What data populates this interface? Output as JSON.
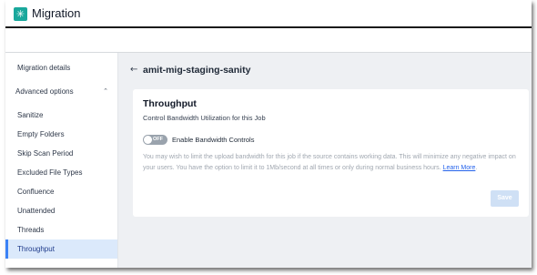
{
  "app": {
    "title": "Migration",
    "logo_icon": "snowflake-icon"
  },
  "sidebar": {
    "items": [
      {
        "label": "Migration details"
      },
      {
        "label": "Advanced options",
        "expanded": true
      },
      {
        "label": "Sanitize"
      },
      {
        "label": "Empty Folders"
      },
      {
        "label": "Skip Scan Period"
      },
      {
        "label": "Excluded File Types"
      },
      {
        "label": "Confluence"
      },
      {
        "label": "Unattended"
      },
      {
        "label": "Threads"
      },
      {
        "label": "Throughput",
        "active": true
      }
    ]
  },
  "header": {
    "back_icon": "back-arrow-icon",
    "job_name": "amit-mig-staging-sanity"
  },
  "card": {
    "title": "Throughput",
    "subtitle": "Control Bandwidth Utilization for this Job",
    "toggle": {
      "state": "OFF",
      "label": "Enable Bandwidth Controls"
    },
    "description": "You may wish to limit the upload bandwidth for this job if the source contains working data. This will minimize any negative impact on your users. You have the option to limit it to 1Mb/second at all times or only during normal business hours.",
    "learn_more": "Learn More",
    "after_link": ".",
    "save_label": "Save"
  },
  "colors": {
    "brand": "#1aa89c",
    "active_bg": "#dbe9fb",
    "active_border": "#3b82f6",
    "link": "#2563eb",
    "save_disabled": "#cfe0f5"
  }
}
